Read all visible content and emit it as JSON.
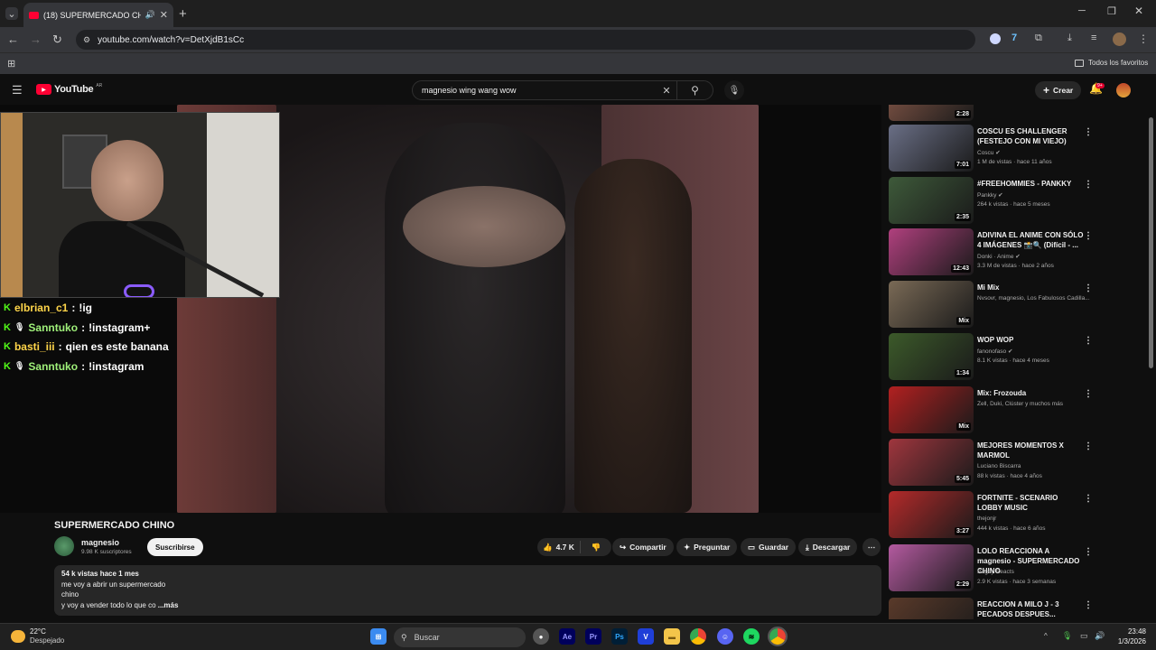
{
  "browser": {
    "tab_title": "(18) SUPERMERCADO CHINO",
    "url": "youtube.com/watch?v=DetXjdB1sCc",
    "bookmarks_label": "Todos los favoritos",
    "window_controls": [
      "minimize-icon",
      "restore-icon",
      "close-icon"
    ]
  },
  "youtube": {
    "logo": "YouTube",
    "region": "AR",
    "search_value": "magnesio wing wang wow",
    "create_label": "Crear",
    "notif_badge": "9+"
  },
  "chat": [
    {
      "user": "elbrian_c1",
      "msg": "!ig",
      "mic": false
    },
    {
      "user": "Sanntuko",
      "msg": "!instagram+",
      "mic": true
    },
    {
      "user": "basti_iii",
      "msg": "qien es este banana",
      "mic": false
    },
    {
      "user": "Sanntuko",
      "msg": "!instagram",
      "mic": true
    }
  ],
  "video": {
    "title": "SUPERMERCADO CHINO",
    "channel": "magnesio",
    "subs": "9.98 K suscriptores",
    "subscribe_label": "Suscribirse",
    "likes": "4.7 K",
    "share_label": "Compartir",
    "ask_label": "Preguntar",
    "save_label": "Guardar",
    "download_label": "Descargar",
    "views_line": "54 k vistas  hace 1 mes",
    "desc_lines": [
      "me voy a abrir un supermercado",
      "chino",
      "y voy a vender todo lo que co"
    ],
    "more_label": "...más"
  },
  "sidebar": [
    {
      "title": "",
      "channel": "",
      "meta": "",
      "dur": "2:28",
      "color": "#8a5a4a"
    },
    {
      "title": "COSCU ES CHALLENGER (FESTEJO CON MI VIEJO)",
      "channel": "Coscu",
      "verified": true,
      "meta": "1 M de vistas · hace 11 años",
      "dur": "7:01",
      "color": "#6a6f86"
    },
    {
      "title": "#FREEHOMMIES - PANKKY",
      "channel": "Pankky",
      "verified": true,
      "meta": "264 k vistas · hace 5 meses",
      "dur": "2:35",
      "color": "#3e5a3a"
    },
    {
      "title": "ADIVINA EL ANIME CON SÓLO 4 IMÁGENES 📸🔍 (Difícil - ...",
      "channel": "Donki · Anime",
      "verified": true,
      "meta": "3.3 M de vistas · hace 2 años",
      "dur": "12:43",
      "color": "#b0407e"
    },
    {
      "title": "Mi Mix",
      "channel": "Nvsovr, magnesio, Los Fabulosos Cadilla...",
      "meta": "",
      "dur": "Mix",
      "color": "#7a6a56"
    },
    {
      "title": "WOP WOP",
      "channel": "fanonofaso",
      "verified": true,
      "meta": "8.1 K vistas · hace 4 meses",
      "dur": "1:34",
      "color": "#3c5a2a"
    },
    {
      "title": "Mix: Frozouda",
      "channel": "Zell, Duki, Clúster y muchos más",
      "meta": "",
      "dur": "Mix",
      "color": "#b22020"
    },
    {
      "title": "MEJORES MOMENTOS X MARMOL",
      "channel": "Luciano Biscarra",
      "meta": "88 k vistas · hace 4 años",
      "dur": "5:45",
      "color": "#a0363e"
    },
    {
      "title": "FORTNITE - SCENARIO LOBBY MUSIC",
      "channel": "thejonjr",
      "meta": "444 k vistas · hace 6 años",
      "dur": "3:27",
      "color": "#b42a2a"
    },
    {
      "title": "LOLO REACCIONA A magnesio - SUPERMERCADO CHINO",
      "channel": "Ragey Reacts",
      "meta": "2.9 K vistas · hace 3 semanas",
      "dur": "2:29",
      "color": "#b45aa0"
    },
    {
      "title": "REACCION A MILO J - 3 PECADOS DESPUES...",
      "channel": "",
      "meta": "",
      "dur": "",
      "color": "#5a3a2a"
    }
  ],
  "taskbar": {
    "temp": "22°C",
    "weather": "Despejado",
    "search_placeholder": "Buscar",
    "time": "23:48",
    "date": "1/3/2026"
  }
}
